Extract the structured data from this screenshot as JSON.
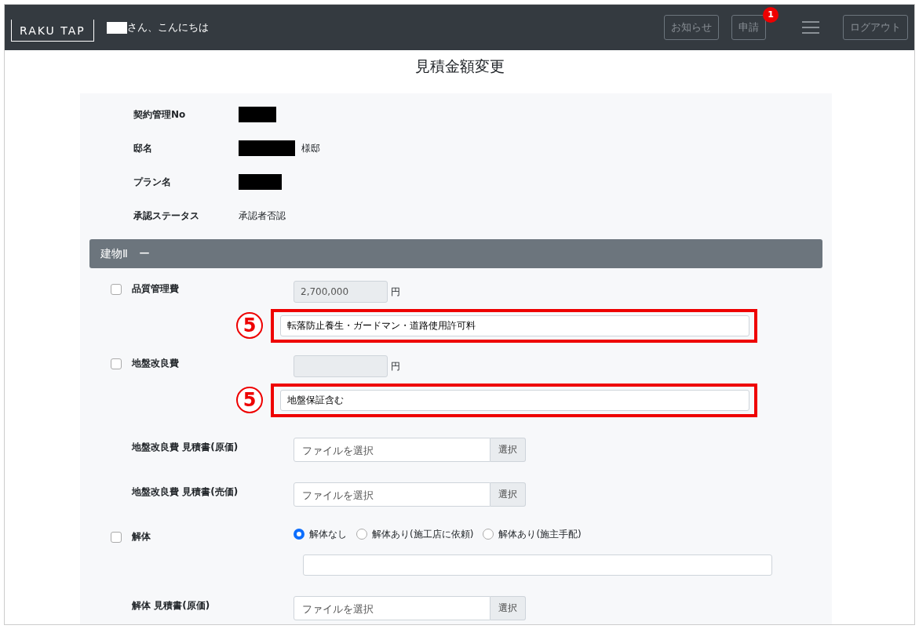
{
  "header": {
    "logo": "RAKU TAP",
    "greeting": "さん、こんにちは",
    "buttons": [
      {
        "label": "お知らせ"
      },
      {
        "label": "申請",
        "badge": "1"
      }
    ],
    "logout": "ログアウト"
  },
  "title": "見積金額変更",
  "info": [
    {
      "label": "契約管理No",
      "redacted": true
    },
    {
      "label": "邸名",
      "redacted": true,
      "suffix": "様邸"
    },
    {
      "label": "プラン名",
      "redacted": true
    },
    {
      "label": "承認ステータス",
      "value": "承認者否認"
    }
  ],
  "section": {
    "title": "建物Ⅱ",
    "toggle": "ー"
  },
  "rows": [
    {
      "kind": "amount",
      "checked": false,
      "label": "品質管理費",
      "value": "2,700,000",
      "unit": "円"
    },
    {
      "kind": "note",
      "marker": "5",
      "value": "転落防止養生・ガードマン・道路使用許可料"
    },
    {
      "kind": "amount",
      "checked": false,
      "label": "地盤改良費",
      "unit": "円"
    },
    {
      "kind": "note",
      "marker": "5",
      "value": "地盤保証含む"
    },
    {
      "kind": "file",
      "label": "地盤改良費 見積書(原価)",
      "placeholder": "ファイルを選択",
      "button": "選択"
    },
    {
      "kind": "file",
      "label": "地盤改良費 見積書(売価)",
      "placeholder": "ファイルを選択",
      "button": "選択"
    },
    {
      "kind": "radio",
      "checked": false,
      "label": "解体",
      "options": [
        {
          "label": "解体なし",
          "selected": true
        },
        {
          "label": "解体あり(施工店に依頼)",
          "selected": false
        },
        {
          "label": "解体あり(施主手配)",
          "selected": false
        }
      ]
    },
    {
      "kind": "note"
    },
    {
      "kind": "file",
      "label": "解体 見積書(原価)",
      "placeholder": "ファイルを選択",
      "button": "選択"
    }
  ]
}
